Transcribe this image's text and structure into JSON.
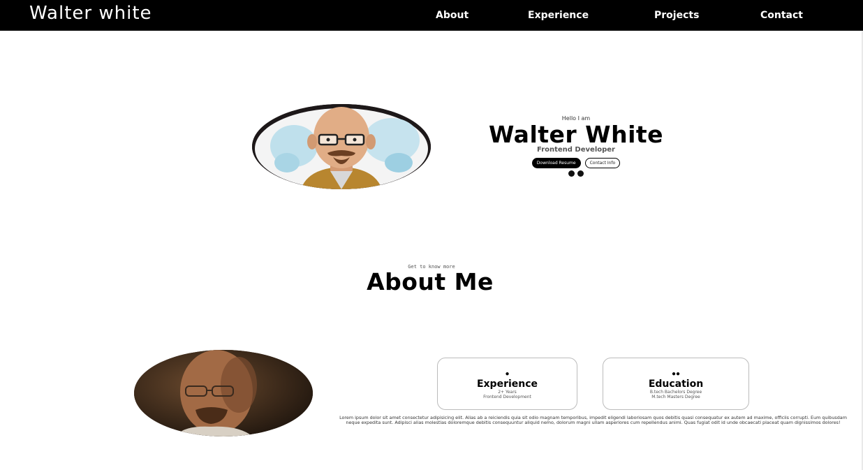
{
  "nav": {
    "brand": "Walter white",
    "links": [
      "About",
      "Experience",
      "Projects",
      "Contact"
    ]
  },
  "hero": {
    "greeting": "Hello I am",
    "name": "Walter White",
    "role": "Frontend Developer",
    "download_label": "Download Resume",
    "contact_label": "Contact Info",
    "socials": [
      "github-icon",
      "linkedin-icon"
    ]
  },
  "about": {
    "subtitle": "Get to know more",
    "title": "About Me",
    "cards": [
      {
        "icon": "person-icon",
        "title": "Experience",
        "lines": [
          "2+ Years",
          "Frontend Development"
        ]
      },
      {
        "icon": "group-icon",
        "title": "Education",
        "lines": [
          "B.tech Bachelors Degree",
          "M.tech Masters Degree"
        ]
      }
    ],
    "description": "Lorem ipsum dolor sit amet consectetur adipisicing elit. Alias ab a reiciendis quia sit odio magnam temporibus, impedit eligendi laboriosam quos debitis quasi consequatur ex autem ad maxime, officiis corrupti. Eum quibusdam neque expedita sunt. Adipisci alias molestias doloremque debitis consequuntur aliquid nemo, dolorum magni ullam asperiores cum repellendus animi. Quas fugiat odit id unde obcaecati placeat quam dignissimos dolores!"
  },
  "colors": {
    "nav_background": "#000000",
    "page_background": "#ffffff",
    "button_dark": "#000000"
  }
}
